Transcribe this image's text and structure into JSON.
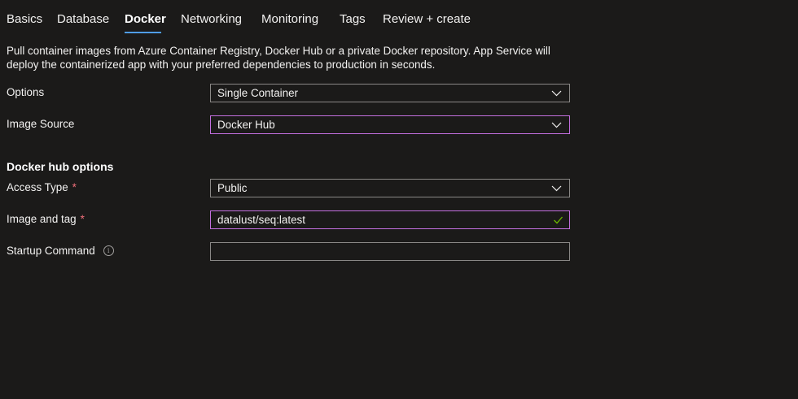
{
  "tabs": [
    {
      "label": "Basics"
    },
    {
      "label": "Database"
    },
    {
      "label": "Docker"
    },
    {
      "label": "Networking"
    },
    {
      "label": "Monitoring"
    },
    {
      "label": "Tags"
    },
    {
      "label": "Review + create"
    }
  ],
  "active_tab": "Docker",
  "description": "Pull container images from Azure Container Registry, Docker Hub or a private Docker repository. App Service will deploy the containerized app with your preferred dependencies to production in seconds.",
  "form": {
    "options": {
      "label": "Options",
      "value": "Single Container"
    },
    "image_source": {
      "label": "Image Source",
      "value": "Docker Hub"
    }
  },
  "docker_hub": {
    "heading": "Docker hub options",
    "access_type": {
      "label": "Access Type",
      "required_mark": "*",
      "value": "Public"
    },
    "image_and_tag": {
      "label": "Image and tag",
      "required_mark": "*",
      "value": "datalust/seq:latest"
    },
    "startup_command": {
      "label": "Startup Command",
      "value": ""
    }
  },
  "icons": {
    "dropdown": "chevron-down-icon",
    "valid": "checkmark-icon",
    "info": "info-icon"
  },
  "colors": {
    "background": "#1b1a19",
    "accent_tab": "#4f9de6",
    "focus_border": "#c36fe0",
    "required": "#f1707b",
    "valid_check": "#6bb700"
  }
}
